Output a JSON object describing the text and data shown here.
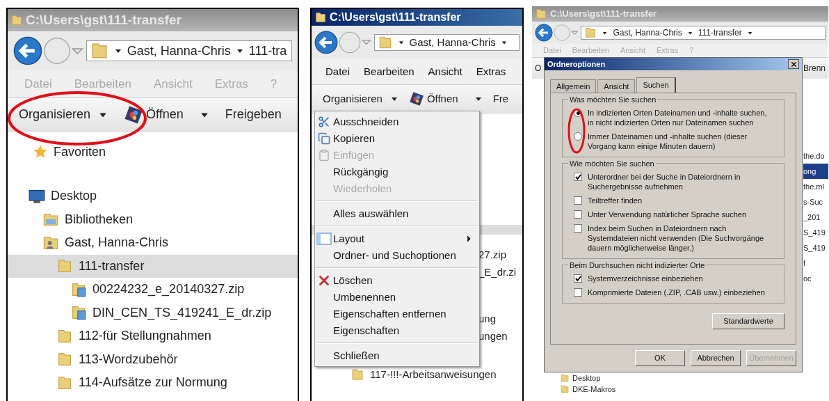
{
  "left_window": {
    "title": "C:\\Users\\gst\\111-transfer",
    "active": false,
    "breadcrumb": [
      "Gast, Hanna-Chris",
      "111-tra"
    ],
    "menu": {
      "disabled": true,
      "items": [
        "Datei",
        "Bearbeiten",
        "Ansicht",
        "Extras",
        "?"
      ]
    },
    "toolbar": [
      {
        "label": "Organisieren",
        "kind": "dropdown"
      },
      {
        "label": "Öffnen",
        "kind": "open"
      },
      {
        "label": "Freigeben",
        "kind": "plain"
      }
    ],
    "favorites": "Favoriten",
    "tree": [
      {
        "label": "Desktop",
        "kind": "desktop",
        "selected": false,
        "children": [
          {
            "label": "Bibliotheken",
            "kind": "library",
            "selected": false
          },
          {
            "label": "Gast, Hanna-Chris",
            "kind": "user",
            "selected": false,
            "children": [
              {
                "label": "111-transfer",
                "kind": "folder",
                "selected": true,
                "children": [
                  {
                    "label": "00224232_e_20140327.zip",
                    "kind": "zip",
                    "selected": false
                  },
                  {
                    "label": "DIN_CEN_TS_419241_E_dr.zip",
                    "kind": "zip",
                    "selected": false
                  }
                ]
              },
              {
                "label": "112-für Stellungnahmen",
                "kind": "folder",
                "selected": false
              },
              {
                "label": "113-Wordzubehör",
                "kind": "folder",
                "selected": false
              },
              {
                "label": "114-Aufsätze zur Normung",
                "kind": "folder",
                "selected": false
              }
            ]
          }
        ]
      }
    ]
  },
  "middle_window": {
    "title": "C:\\Users\\gst\\111-transfer",
    "active": true,
    "breadcrumb": [
      "Gast, Hanna-Chris"
    ],
    "menu": {
      "disabled": false,
      "items": [
        "Datei",
        "Bearbeiten",
        "Ansicht",
        "Extras"
      ]
    },
    "toolbar": [
      {
        "label": "Organisieren",
        "kind": "dropdown"
      },
      {
        "label": "Öffnen",
        "kind": "open"
      },
      {
        "label": "Fre",
        "kind": "plain"
      }
    ],
    "context_menu": [
      [
        {
          "label": "Ausschneiden",
          "kind": "cut",
          "disabled": false,
          "submenu": false
        },
        {
          "label": "Kopieren",
          "kind": "copy",
          "disabled": false,
          "submenu": false
        },
        {
          "label": "Einfügen",
          "kind": "paste",
          "disabled": true,
          "submenu": false
        },
        {
          "label": "Rückgängig",
          "kind": "plain",
          "disabled": false,
          "submenu": false
        },
        {
          "label": "Wiederholen",
          "kind": "plain",
          "disabled": true,
          "submenu": false
        }
      ],
      [
        {
          "label": "Alles auswählen",
          "kind": "plain",
          "disabled": false,
          "submenu": false
        }
      ],
      [
        {
          "label": "Layout",
          "kind": "layout",
          "disabled": false,
          "submenu": true
        },
        {
          "label": "Ordner- und Suchoptionen",
          "kind": "plain",
          "disabled": false,
          "submenu": false
        }
      ],
      [
        {
          "label": "Löschen",
          "kind": "delete",
          "disabled": false,
          "submenu": false
        },
        {
          "label": "Umbenennen",
          "kind": "plain",
          "disabled": false,
          "submenu": false
        },
        {
          "label": "Eigenschaften entfernen",
          "kind": "plain",
          "disabled": false,
          "submenu": false
        },
        {
          "label": "Eigenschaften",
          "kind": "plain",
          "disabled": false,
          "submenu": false
        }
      ],
      [
        {
          "label": "Schließen",
          "kind": "plain",
          "disabled": false,
          "submenu": false
        }
      ]
    ],
    "file_fragments": [
      "27.zip",
      "_E_dr.zi"
    ],
    "folder_fragments": [
      "ung",
      "ungen"
    ],
    "folder_below": "117-!!!-Arbeitsanweisungen"
  },
  "right_window": {
    "title": "C:\\Users\\gst\\111-transfer",
    "active": false,
    "breadcrumb": [
      "Gast, Hanna-Chris",
      "111-transfer"
    ],
    "menu": {
      "disabled": true,
      "items": [
        "Datei",
        "Bearbeiten",
        "Ansicht",
        "Extras",
        "?"
      ]
    },
    "toolbar_fragment": "O",
    "toolbar_right_fragment": "Brenn",
    "list_fragments": [
      {
        "label": "the.do",
        "selected": false
      },
      {
        "label": "ong",
        "selected": true
      },
      {
        "label": "the.ml",
        "selected": false
      },
      {
        "label": "s-Suc",
        "selected": false
      },
      {
        "label": "_201",
        "selected": false
      },
      {
        "label": "S_419",
        "selected": false
      },
      {
        "label": "S_419",
        "selected": false
      },
      {
        "label": "f",
        "selected": false
      },
      {
        "label": "oc",
        "selected": false
      }
    ],
    "tree_fragments": [
      "Desktop",
      "DKE-Makros"
    ],
    "dialog": {
      "title": "Ordneroptionen",
      "tabs": [
        {
          "label": "Allgemein",
          "selected": false
        },
        {
          "label": "Ansicht",
          "selected": false
        },
        {
          "label": "Suchen",
          "selected": true
        }
      ],
      "groups": [
        {
          "title": "Was möchten Sie suchen",
          "options": [
            {
              "kind": "radio",
              "label": "In indizierten Orten Dateinamen und -inhalte suchen, in nicht indizierten Orten nur Dateinamen suchen",
              "selected": true
            },
            {
              "kind": "radio",
              "label": "Immer Dateinamen und -inhalte suchen (dieser Vorgang kann einige Minuten dauern)",
              "selected": false
            }
          ]
        },
        {
          "title": "Wie möchten Sie suchen",
          "options": [
            {
              "kind": "checkbox",
              "label": "Unterordner bei der Suche in Dateiordnern in Suchergebnisse aufnehmen",
              "checked": true
            },
            {
              "kind": "checkbox",
              "label": "Teiltreffer finden",
              "checked": false
            },
            {
              "kind": "checkbox",
              "label": "Unter Verwendung natürlicher Sprache suchen",
              "checked": false
            },
            {
              "kind": "checkbox",
              "label": "Index beim Suchen in Dateiordnern nach Systemdateien nicht verwenden (Die Suchvorgänge dauern möglicherweise länger.)",
              "checked": false
            }
          ]
        },
        {
          "title": "Beim Durchsuchen nicht indizierter Orte",
          "options": [
            {
              "kind": "checkbox",
              "label": "Systemverzeichnisse einbeziehen",
              "checked": true
            },
            {
              "kind": "checkbox",
              "label": "Komprimierte Dateien (.ZIP, .CAB usw.) einbeziehen",
              "checked": false
            }
          ]
        }
      ],
      "reset_button": "Standardwerte",
      "buttons": [
        {
          "label": "OK",
          "disabled": false
        },
        {
          "label": "Abbrechen",
          "disabled": false
        },
        {
          "label": "Übernehmen",
          "disabled": true
        }
      ]
    }
  }
}
